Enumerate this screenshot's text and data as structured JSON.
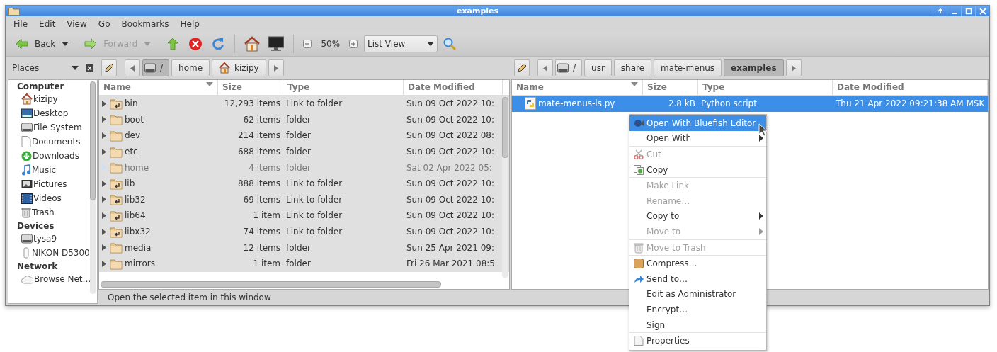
{
  "window": {
    "title": "examples"
  },
  "menubar": [
    "File",
    "Edit",
    "View",
    "Go",
    "Bookmarks",
    "Help"
  ],
  "toolbar": {
    "back": {
      "label": "Back",
      "disabled": false
    },
    "forward": {
      "label": "Forward",
      "disabled": true
    },
    "zoom": "50%",
    "view": "List View"
  },
  "sidebar": {
    "title": "Places",
    "sections": [
      {
        "heading": "Computer",
        "items": [
          {
            "label": "kizipy",
            "kind": "home"
          },
          {
            "label": "Desktop",
            "kind": "desktop"
          },
          {
            "label": "File System",
            "kind": "drive"
          },
          {
            "label": "Documents",
            "kind": "document"
          },
          {
            "label": "Downloads",
            "kind": "download"
          },
          {
            "label": "Music",
            "kind": "music"
          },
          {
            "label": "Pictures",
            "kind": "pictures"
          },
          {
            "label": "Videos",
            "kind": "videos"
          },
          {
            "label": "Trash",
            "kind": "trash"
          }
        ]
      },
      {
        "heading": "Devices",
        "items": [
          {
            "label": "tysa9",
            "kind": "drive"
          },
          {
            "label": "NIKON D5300",
            "kind": "usb"
          }
        ]
      },
      {
        "heading": "Network",
        "items": [
          {
            "label": "Browse Net…",
            "kind": "network"
          }
        ]
      }
    ]
  },
  "panes": [
    {
      "active": false,
      "path": [
        {
          "label": "/",
          "kind": "root",
          "selected": true
        },
        {
          "label": "home",
          "kind": "plain",
          "selected": false
        },
        {
          "label": "kizipy",
          "kind": "home",
          "selected": false
        }
      ],
      "columns": [
        "Name",
        "Size",
        "Type",
        "Date Modified"
      ],
      "rows": [
        {
          "name": "bin",
          "size": "12,293 items",
          "type": "Link to folder",
          "date": "Sun 09 Oct 2022 10:",
          "kind": "link",
          "selected": true,
          "dimmed": false
        },
        {
          "name": "boot",
          "size": "62 items",
          "type": "folder",
          "date": "Sun 09 Oct 2022 10:",
          "kind": "folder",
          "selected": true,
          "dimmed": false
        },
        {
          "name": "dev",
          "size": "214 items",
          "type": "folder",
          "date": "Sun 09 Oct 2022 08:",
          "kind": "folder",
          "selected": true,
          "dimmed": false
        },
        {
          "name": "etc",
          "size": "688 items",
          "type": "folder",
          "date": "Sun 09 Oct 2022 10:",
          "kind": "folder",
          "selected": true,
          "dimmed": false
        },
        {
          "name": "home",
          "size": "4 items",
          "type": "folder",
          "date": "Sat 02 Apr 2022 05:",
          "kind": "folder",
          "selected": true,
          "dimmed": true
        },
        {
          "name": "lib",
          "size": "888 items",
          "type": "Link to folder",
          "date": "Sun 09 Oct 2022 10:",
          "kind": "link",
          "selected": true,
          "dimmed": false
        },
        {
          "name": "lib32",
          "size": "69 items",
          "type": "Link to folder",
          "date": "Sun 09 Oct 2022 10:",
          "kind": "link",
          "selected": true,
          "dimmed": false
        },
        {
          "name": "lib64",
          "size": "1 item",
          "type": "Link to folder",
          "date": "Sun 09 Oct 2022 10:",
          "kind": "link",
          "selected": true,
          "dimmed": false
        },
        {
          "name": "libx32",
          "size": "74 items",
          "type": "Link to folder",
          "date": "Sun 09 Oct 2022 10:",
          "kind": "link",
          "selected": true,
          "dimmed": false
        },
        {
          "name": "media",
          "size": "12 items",
          "type": "folder",
          "date": "Sun 25 Apr 2021 09:",
          "kind": "folder",
          "selected": true,
          "dimmed": false
        },
        {
          "name": "mirrors",
          "size": "1 item",
          "type": "folder",
          "date": "Fri 26 Mar 2021 08:5",
          "kind": "folder",
          "selected": true,
          "dimmed": false
        }
      ]
    },
    {
      "active": true,
      "path": [
        {
          "label": "/",
          "kind": "root",
          "selected": false
        },
        {
          "label": "usr",
          "kind": "plain",
          "selected": false
        },
        {
          "label": "share",
          "kind": "plain",
          "selected": false
        },
        {
          "label": "mate-menus",
          "kind": "plain",
          "selected": false
        },
        {
          "label": "examples",
          "kind": "plain",
          "selected": true
        }
      ],
      "columns": [
        "Name",
        "Size",
        "Type",
        "Date Modified"
      ],
      "rows": [
        {
          "name": "mate-menus-ls.py",
          "size": "2.8  kB",
          "type": "Python script",
          "date": "Thu 21 Apr 2022 09:21:38 AM MSK",
          "kind": "script",
          "selected": true,
          "dimmed": false
        }
      ]
    }
  ],
  "status_bar": "Open the selected item in this window",
  "context_menu": {
    "items": [
      {
        "kind": "item",
        "label": "Open With Bluefish Editor",
        "highlighted": true,
        "disabled": false,
        "submenu": false
      },
      {
        "kind": "item",
        "label": "Open With",
        "highlighted": false,
        "disabled": false,
        "submenu": true
      },
      {
        "kind": "separator"
      },
      {
        "kind": "item",
        "label": "Cut",
        "highlighted": false,
        "disabled": true,
        "submenu": false
      },
      {
        "kind": "item",
        "label": "Copy",
        "highlighted": false,
        "disabled": false,
        "submenu": false
      },
      {
        "kind": "separator"
      },
      {
        "kind": "item",
        "label": "Make Link",
        "highlighted": false,
        "disabled": true,
        "submenu": false
      },
      {
        "kind": "item",
        "label": "Rename…",
        "highlighted": false,
        "disabled": true,
        "submenu": false
      },
      {
        "kind": "item",
        "label": "Copy to",
        "highlighted": false,
        "disabled": false,
        "submenu": true
      },
      {
        "kind": "item",
        "label": "Move to",
        "highlighted": false,
        "disabled": true,
        "submenu": true
      },
      {
        "kind": "separator"
      },
      {
        "kind": "item",
        "label": "Move to Trash",
        "highlighted": false,
        "disabled": true,
        "submenu": false
      },
      {
        "kind": "separator"
      },
      {
        "kind": "item",
        "label": "Compress…",
        "highlighted": false,
        "disabled": false,
        "submenu": false
      },
      {
        "kind": "item",
        "label": "Send to…",
        "highlighted": false,
        "disabled": false,
        "submenu": false
      },
      {
        "kind": "item",
        "label": "Edit as Administrator",
        "highlighted": false,
        "disabled": false,
        "submenu": false
      },
      {
        "kind": "item",
        "label": "Encrypt…",
        "highlighted": false,
        "disabled": false,
        "submenu": false
      },
      {
        "kind": "item",
        "label": "Sign",
        "highlighted": false,
        "disabled": false,
        "submenu": false
      },
      {
        "kind": "separator"
      },
      {
        "kind": "item",
        "label": "Properties",
        "highlighted": false,
        "disabled": false,
        "submenu": false
      }
    ]
  }
}
